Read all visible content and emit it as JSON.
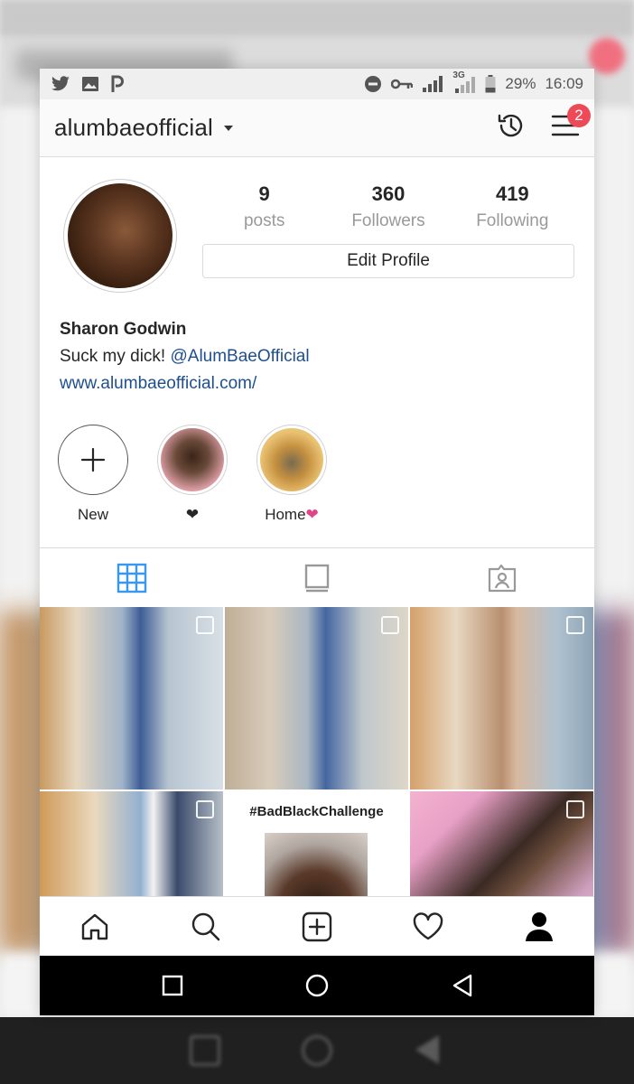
{
  "status_bar": {
    "battery": "29%",
    "time": "16:09",
    "network": "3G"
  },
  "header": {
    "username": "alumbaeofficial",
    "notification_count": "2"
  },
  "profile": {
    "stats": [
      {
        "value": "9",
        "label": "posts"
      },
      {
        "value": "360",
        "label": "Followers"
      },
      {
        "value": "419",
        "label": "Following"
      }
    ],
    "edit_button": "Edit Profile",
    "name": "Sharon Godwin",
    "bio_prefix": "Suck my dick!",
    "bio_mention": "@AlumBaeOfficial",
    "website": "www.alumbaeofficial.com/"
  },
  "highlights": [
    {
      "label": "New"
    },
    {
      "label": "❤"
    },
    {
      "label": "Home",
      "suffix": "❤"
    }
  ],
  "grid": {
    "challenge_caption": "#BadBlackChallenge"
  },
  "colors": {
    "accent_blue": "#3897f0",
    "link": "#1e4f8c",
    "badge": "#ed4956",
    "heart_pink": "#e0458a"
  },
  "icons": {
    "status_left": [
      "twitter-icon",
      "image-icon",
      "p-icon"
    ],
    "status_right": [
      "dnd-icon",
      "key-icon",
      "signal-icon",
      "battery-icon"
    ],
    "header": [
      "archive-icon",
      "hamburger-menu-icon"
    ],
    "tabs": [
      "grid-icon",
      "feed-icon",
      "tagged-icon"
    ],
    "bottom_nav": [
      "home-icon",
      "search-icon",
      "add-post-icon",
      "heart-icon",
      "profile-icon"
    ],
    "system_nav": [
      "recents-icon",
      "home-circle-icon",
      "back-icon"
    ]
  }
}
